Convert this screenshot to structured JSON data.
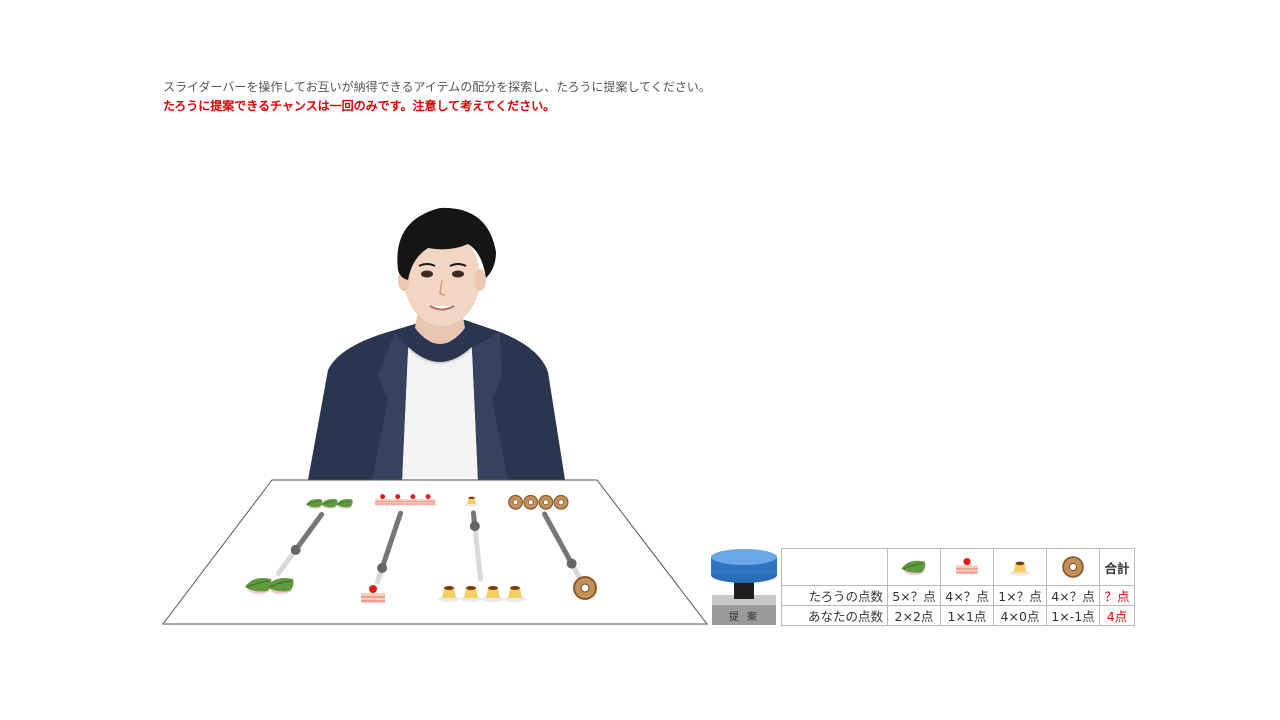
{
  "instructions": {
    "line1": "スライダーバーを操作してお互いが納得できるアイテムの配分を探索し、たろうに提案してください。",
    "line2": "たろうに提案できるチャンスは一回のみです。注意して考えてください。"
  },
  "items": [
    {
      "name": "kashiwa-mochi",
      "total": 5,
      "taro_share": 3,
      "user_share": 2
    },
    {
      "name": "strawberry-cake",
      "total": 5,
      "taro_share": 4,
      "user_share": 1
    },
    {
      "name": "pudding",
      "total": 5,
      "taro_share": 1,
      "user_share": 4
    },
    {
      "name": "donut",
      "total": 5,
      "taro_share": 4,
      "user_share": 1
    }
  ],
  "propose_button": {
    "label": "提案"
  },
  "score_table": {
    "total_header": "合計",
    "taro_row": {
      "label": "たろうの点数",
      "cells": [
        "5×？点",
        "4×？点",
        "1×？点",
        "4×？点"
      ],
      "total": "？点"
    },
    "user_row": {
      "label": "あなたの点数",
      "cells": [
        "2×2点",
        "1×1点",
        "4×0点",
        "1×-1点"
      ],
      "total": "4点"
    }
  }
}
